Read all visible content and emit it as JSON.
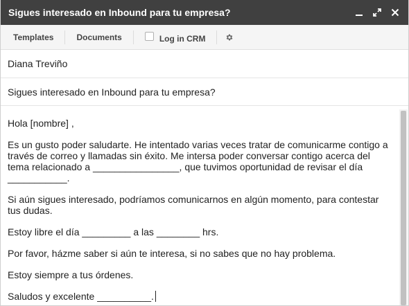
{
  "window": {
    "title": "Sigues interesado en Inbound para tu empresa?",
    "controls": [
      "minimize-icon",
      "expand-icon",
      "close-icon"
    ]
  },
  "toolbar": {
    "templates": "Templates",
    "documents": "Documents",
    "log_in_crm": "Log in CRM",
    "log_in_crm_checked": false,
    "settings_icon": "gear-icon"
  },
  "fields": {
    "to": "Diana Treviño",
    "subject": "Sigues interesado en Inbound para tu empresa?"
  },
  "message": {
    "greeting": "Hola [nombre] ,",
    "paragraph1": "Es un gusto poder saludarte. He intentado varias veces tratar de comunicarme contigo a través de correo y llamadas sin éxito. Me intersa poder conversar contigo acerca del tema relacionado a ________________, que tuvimos oportunidad de revisar el día ___________.",
    "paragraph2": "Si aún sigues interesado, podríamos comunicarnos en algún momento, para contestar tus dudas.",
    "paragraph3": "Estoy libre el día _________ a las ________ hrs.",
    "paragraph4": "Por favor, házme saber si aún te interesa, si no sabes que no hay problema.",
    "paragraph5": "Estoy siempre a tus órdenes.",
    "closing": "Saludos y excelente __________."
  },
  "colors": {
    "titlebar": "#404040",
    "toolbar": "#f5f5f5",
    "text": "#222222"
  }
}
